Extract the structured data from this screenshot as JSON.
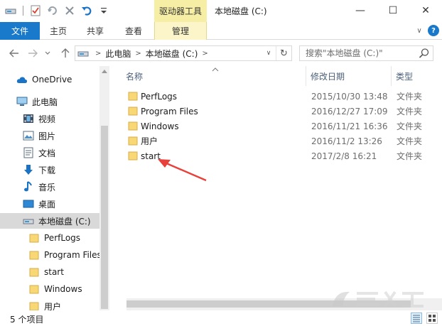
{
  "window": {
    "title": "本地磁盘 (C:)",
    "context_tab_group": "驱动器工具",
    "minimize_glyph": "—",
    "maximize_glyph": "☐",
    "close_glyph": "✕"
  },
  "ribbon": {
    "tabs": [
      {
        "label": "文件"
      },
      {
        "label": "主页"
      },
      {
        "label": "共享"
      },
      {
        "label": "查看"
      },
      {
        "label": "管理"
      }
    ],
    "collapse_glyph": "∨",
    "help_glyph": "?"
  },
  "address_bar": {
    "breadcrumbs": [
      "此电脑",
      "本地磁盘 (C:)"
    ],
    "crumb_separator": ">",
    "dropdown_glyph": "∨",
    "refresh_glyph": "↻"
  },
  "search": {
    "placeholder": "搜索\"本地磁盘 (C:)\""
  },
  "navigation_pane": {
    "items": [
      {
        "label": "OneDrive",
        "icon": "cloud-icon"
      },
      {
        "label": "此电脑",
        "icon": "computer-icon"
      },
      {
        "label": "视频",
        "icon": "video-icon"
      },
      {
        "label": "图片",
        "icon": "pictures-icon"
      },
      {
        "label": "文档",
        "icon": "documents-icon"
      },
      {
        "label": "下载",
        "icon": "download-icon"
      },
      {
        "label": "音乐",
        "icon": "music-icon"
      },
      {
        "label": "桌面",
        "icon": "desktop-icon"
      },
      {
        "label": "本地磁盘 (C:)",
        "icon": "drive-icon",
        "selected": true
      },
      {
        "label": "PerfLogs",
        "icon": "folder-icon"
      },
      {
        "label": "Program Files",
        "icon": "folder-icon"
      },
      {
        "label": "start",
        "icon": "folder-icon"
      },
      {
        "label": "Windows",
        "icon": "folder-icon"
      },
      {
        "label": "用户",
        "icon": "folder-icon"
      }
    ]
  },
  "file_list": {
    "columns": [
      "名称",
      "修改日期",
      "类型"
    ],
    "rows": [
      {
        "name": "PerfLogs",
        "modified": "2015/10/30 13:48",
        "type": "文件夹"
      },
      {
        "name": "Program Files",
        "modified": "2016/12/27 17:09",
        "type": "文件夹"
      },
      {
        "name": "Windows",
        "modified": "2016/11/21 16:36",
        "type": "文件夹"
      },
      {
        "name": "用户",
        "modified": "2016/11/2 13:26",
        "type": "文件夹"
      },
      {
        "name": "start",
        "modified": "2017/2/8 16:21",
        "type": "文件夹"
      }
    ]
  },
  "status_bar": {
    "item_count": "5 个项目"
  },
  "colors": {
    "file_tab_blue": "#1979ca",
    "context_tab_yellow": "#f6eea5",
    "folder_yellow": "#f8d775",
    "selection_gray": "#d9d9d9",
    "annotation_red": "#e8403a"
  }
}
